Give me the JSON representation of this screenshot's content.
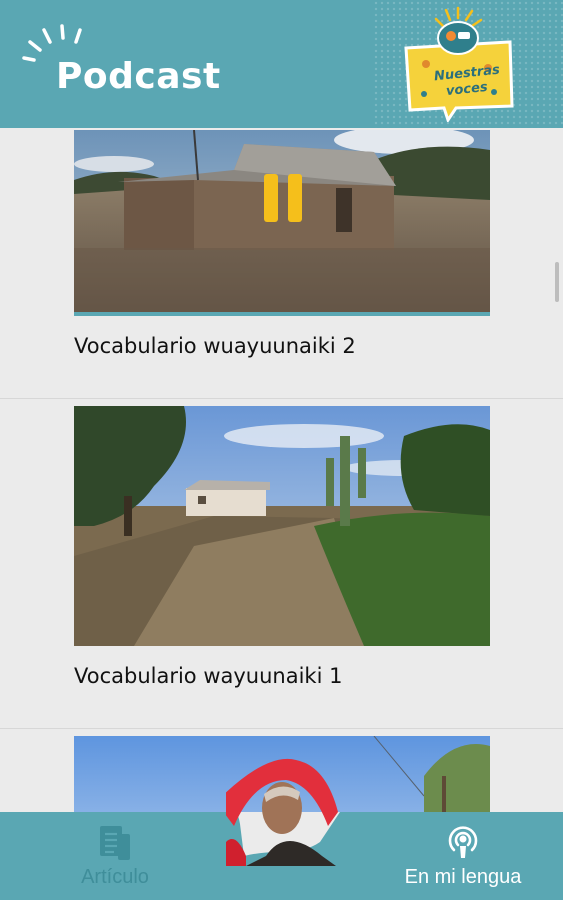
{
  "header": {
    "title": "Podcast",
    "logo_text_line1": "Nuestras",
    "logo_text_line2": "voces"
  },
  "episodes": [
    {
      "title": "Vocabulario wuayuunaiki 2",
      "state": "playing"
    },
    {
      "title": "Vocabulario wayuunaiki 1",
      "state": "idle"
    },
    {
      "title": "",
      "state": "idle"
    }
  ],
  "bottom_nav": {
    "tabs": [
      {
        "label": "Artículo",
        "icon": "article-icon",
        "active": false
      },
      {
        "label": "En mi lengua",
        "icon": "podcast-icon",
        "active": true
      }
    ]
  },
  "colors": {
    "header": "#5aa7b3",
    "accent_yellow": "#f5bf1b",
    "background": "#ebebeb",
    "inactive_tab_text": "#3f8e9a"
  }
}
